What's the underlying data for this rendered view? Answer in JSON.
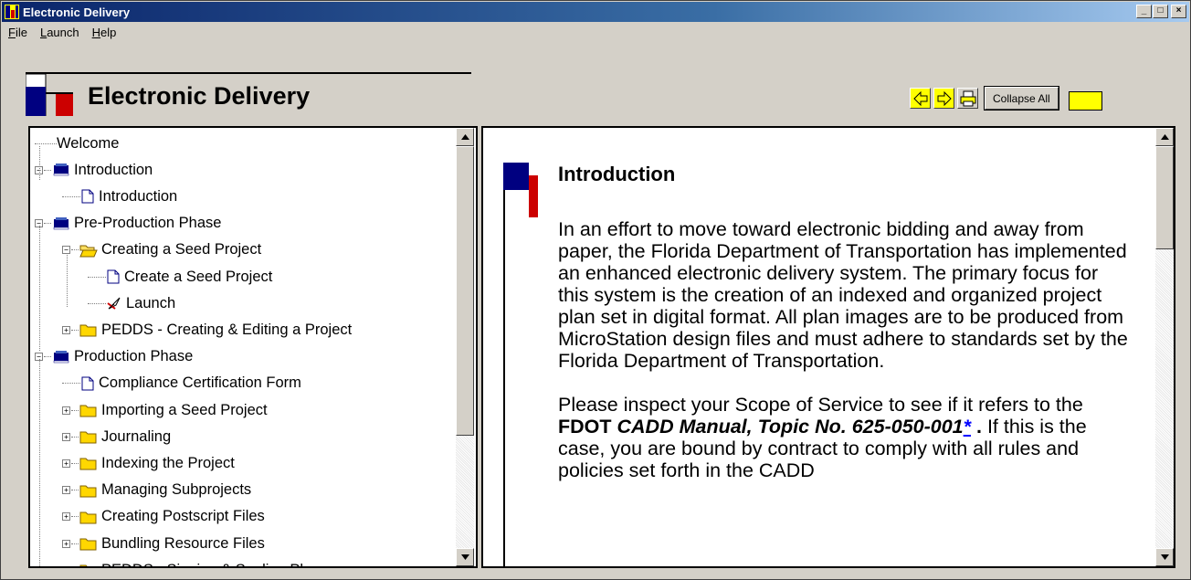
{
  "window": {
    "title": "Electronic Delivery",
    "controls": [
      "_",
      "□",
      "×"
    ]
  },
  "menu": [
    "File",
    "Launch",
    "Help"
  ],
  "header": {
    "app_name": "Electronic Delivery",
    "collapse_label": "Collapse All"
  },
  "tree": [
    {
      "label": "Welcome",
      "icon": "none",
      "level": 0
    },
    {
      "label": "Introduction",
      "icon": "book-icon",
      "level": 0,
      "expander": "-"
    },
    {
      "label": "Introduction",
      "icon": "page-icon",
      "level": 1
    },
    {
      "label": "Pre-Production Phase",
      "icon": "book-icon",
      "level": 0,
      "expander": "-"
    },
    {
      "label": "Creating a Seed Project",
      "icon": "open-folder-icon",
      "level": 1,
      "expander": "-"
    },
    {
      "label": "Create a Seed Project",
      "icon": "page-icon",
      "level": 2
    },
    {
      "label": "Launch",
      "icon": "launch-icon",
      "level": 2
    },
    {
      "label": "PEDDS - Creating & Editing a Project",
      "icon": "folder-icon",
      "level": 1,
      "expander": "+"
    },
    {
      "label": "Production Phase",
      "icon": "book-icon",
      "level": 0,
      "expander": "-"
    },
    {
      "label": "Compliance Certification Form",
      "icon": "page-icon",
      "level": 1
    },
    {
      "label": "Importing a Seed Project",
      "icon": "folder-icon",
      "level": 1,
      "expander": "+"
    },
    {
      "label": "Journaling",
      "icon": "folder-icon",
      "level": 1,
      "expander": "+"
    },
    {
      "label": "Indexing the Project",
      "icon": "folder-icon",
      "level": 1,
      "expander": "+"
    },
    {
      "label": "Managing Subprojects",
      "icon": "folder-icon",
      "level": 1,
      "expander": "+"
    },
    {
      "label": "Creating Postscript Files",
      "icon": "folder-icon",
      "level": 1,
      "expander": "+"
    },
    {
      "label": "Bundling Resource Files",
      "icon": "folder-icon",
      "level": 1,
      "expander": "+"
    },
    {
      "label": "PEDDS - Signing & Sealing Plans",
      "icon": "folder-icon",
      "level": 1,
      "expander": "+"
    }
  ],
  "content": {
    "title": "Introduction",
    "para1": "In an effort to move toward electronic bidding and away from paper, the Florida Department of Transportation has implemented an enhanced electronic delivery system. The primary focus for this system is the creation of an indexed and organized project plan set in digital format. All plan images are to be produced from MicroStation design files and must adhere to standards set by the Florida Department of Transportation.",
    "para2_a": "Please inspect your Scope of Service to see if it refers to the ",
    "para2_b": "FDOT ",
    "para2_c": "CADD Manual, Topic No. 625-050-001",
    "para2_link": "*",
    "para2_d": " .",
    "para2_e": " If this is the case, you are bound by contract to comply with all rules and policies set forth in the CADD"
  },
  "colors": {
    "navy": "#000080",
    "red": "#cc0000",
    "yellow": "#ffff00"
  }
}
